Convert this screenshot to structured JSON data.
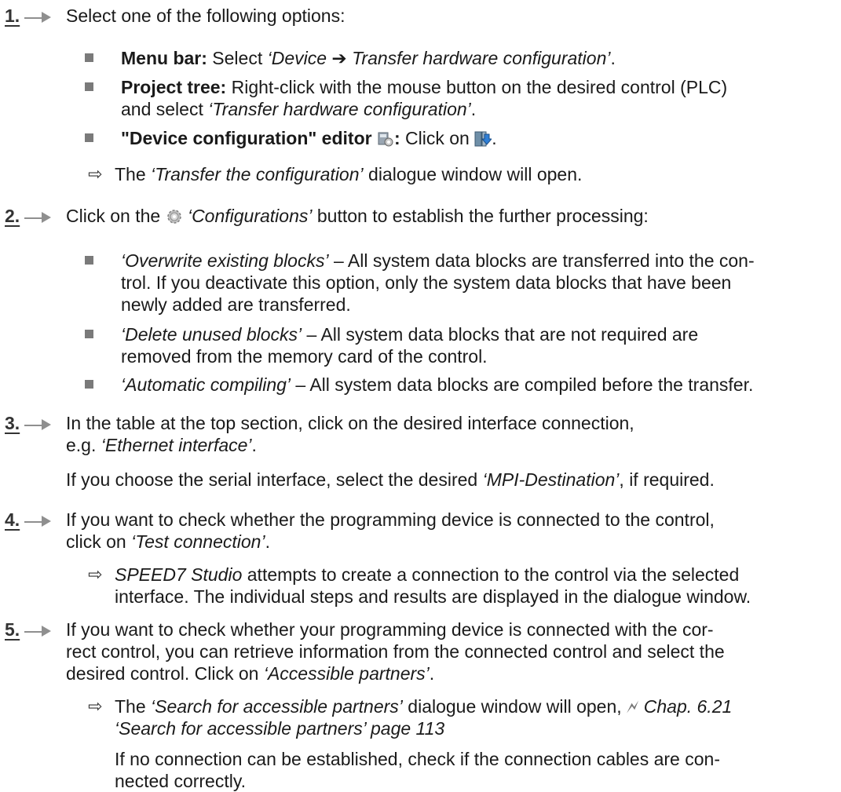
{
  "steps": [
    {
      "num": "1.",
      "text": "Select one of the following options:"
    },
    {
      "num": "2.",
      "text_a": "Click on the",
      "text_b": "‘Configurations’",
      "text_c": " button to establish the further processing:"
    },
    {
      "num": "3.",
      "line1": "In the table at the top section, click on the desired interface connection,",
      "line2a": "e.g. ",
      "line2b": "‘Ethernet interface’",
      "line2c": ".",
      "note_a": "If you choose the serial interface, select the desired ",
      "note_b": "‘MPI-Destination’",
      "note_c": ", if required."
    },
    {
      "num": "4.",
      "line1": "If you want to check whether the programming device is connected to the control,",
      "line2a": "click on ",
      "line2b": "‘Test connection’",
      "line2c": "."
    },
    {
      "num": "5.",
      "line1": "If you want to check whether your programming device is connected with the cor-",
      "line2": "rect control, you can retrieve information from the connected control and select the",
      "line3a": "desired control. Click on ",
      "line3b": "‘Accessible partners’",
      "line3c": "."
    }
  ],
  "step1_bullets": {
    "menu_bold": "Menu bar:",
    "menu_a": " Select ",
    "menu_b": "‘Device ➔ Transfer hardware configuration’",
    "menu_c": ".",
    "tree_bold": "Project tree:",
    "tree_a": " Right-click with the mouse button on the desired control (PLC)",
    "tree_b": "and select ",
    "tree_c": "‘Transfer hardware configuration’",
    "tree_d": ".",
    "editor_bold": "\"Device configuration\" editor",
    "editor_colon": ":",
    "editor_a": " Click on ",
    "editor_end": "."
  },
  "step1_result": {
    "a": "The ",
    "b": "‘Transfer the configuration’",
    "c": " dialogue window will open."
  },
  "step2_bullets": [
    {
      "it": "‘Overwrite existing blocks’",
      "l1": " – All system data blocks are transferred into the con-",
      "l2": "trol. If you deactivate this option, only the system data blocks that have been",
      "l3": "newly added are transferred."
    },
    {
      "it": "‘Delete unused blocks’",
      "l1": " – All system data blocks that are not required are",
      "l2": "removed from the memory card of the control."
    },
    {
      "it": "‘Automatic compiling’",
      "l1": " – All system data blocks are compiled before the transfer."
    }
  ],
  "step4_result": {
    "a": "SPEED7 Studio",
    "b": " attempts to create a connection to the control via the selected",
    "c": "interface. The individual steps and results are displayed in the dialogue window."
  },
  "step5_result": {
    "a": "The ",
    "b": "‘Search for accessible partners’",
    "c": " dialogue window will open, ",
    "link_sym": "🗲",
    "d": "Chap. 6.21",
    "e": "‘Search for accessible partners’ page 113"
  },
  "step5_note": {
    "l1": "If no connection can be established, check if the connection cables are con-",
    "l2": "nected correctly."
  },
  "result_arrow": "⇨",
  "icons": [
    "device-config-icon",
    "transfer-download-icon",
    "gear-icon",
    "link-arrow-icon"
  ]
}
